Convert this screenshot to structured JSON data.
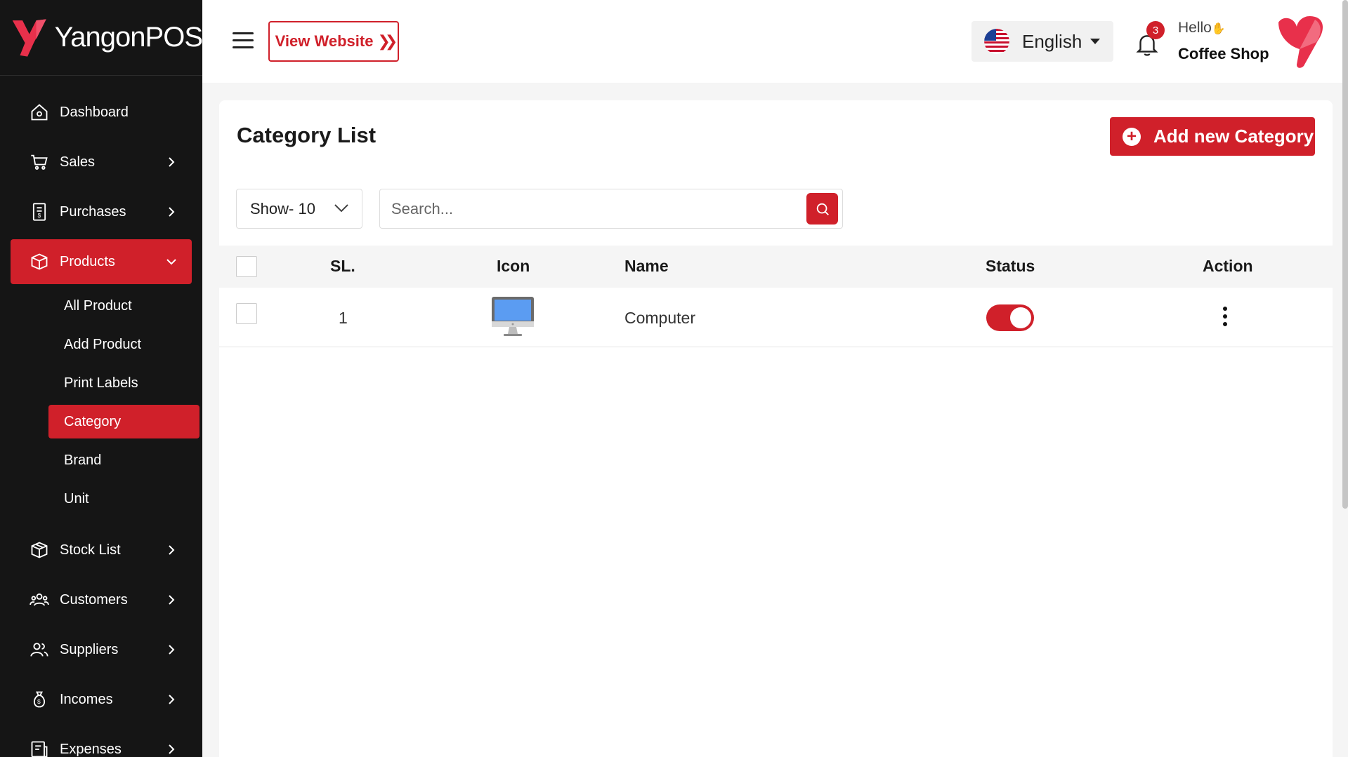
{
  "app": {
    "brand": "YangonPOS",
    "accent_color": "#d0202a"
  },
  "header": {
    "view_website": "View Website",
    "language": "English",
    "notification_count": "3",
    "greeting": "Hello",
    "shop_name": "Coffee Shop"
  },
  "sidebar": {
    "items": [
      {
        "label": "Dashboard",
        "icon": "home-icon"
      },
      {
        "label": "Sales",
        "icon": "cart-icon"
      },
      {
        "label": "Purchases",
        "icon": "receipt-icon"
      },
      {
        "label": "Products",
        "icon": "box-icon"
      },
      {
        "label": "Stock List",
        "icon": "package-icon"
      },
      {
        "label": "Customers",
        "icon": "users-icon"
      },
      {
        "label": "Suppliers",
        "icon": "user-group-icon"
      },
      {
        "label": "Incomes",
        "icon": "money-bag-icon"
      },
      {
        "label": "Expenses",
        "icon": "expense-icon"
      }
    ],
    "products_sub": [
      "All Product",
      "Add Product",
      "Print Labels",
      "Category",
      "Brand",
      "Unit"
    ],
    "active_sub": "Category"
  },
  "page": {
    "title": "Category List",
    "add_button": "Add new Category",
    "show_select": "Show- 10",
    "search_placeholder": "Search..."
  },
  "table": {
    "headers": {
      "sl": "SL.",
      "icon": "Icon",
      "name": "Name",
      "status": "Status",
      "action": "Action"
    },
    "rows": [
      {
        "sl": "1",
        "icon": "computer-icon",
        "name": "Computer",
        "status": true
      }
    ]
  }
}
